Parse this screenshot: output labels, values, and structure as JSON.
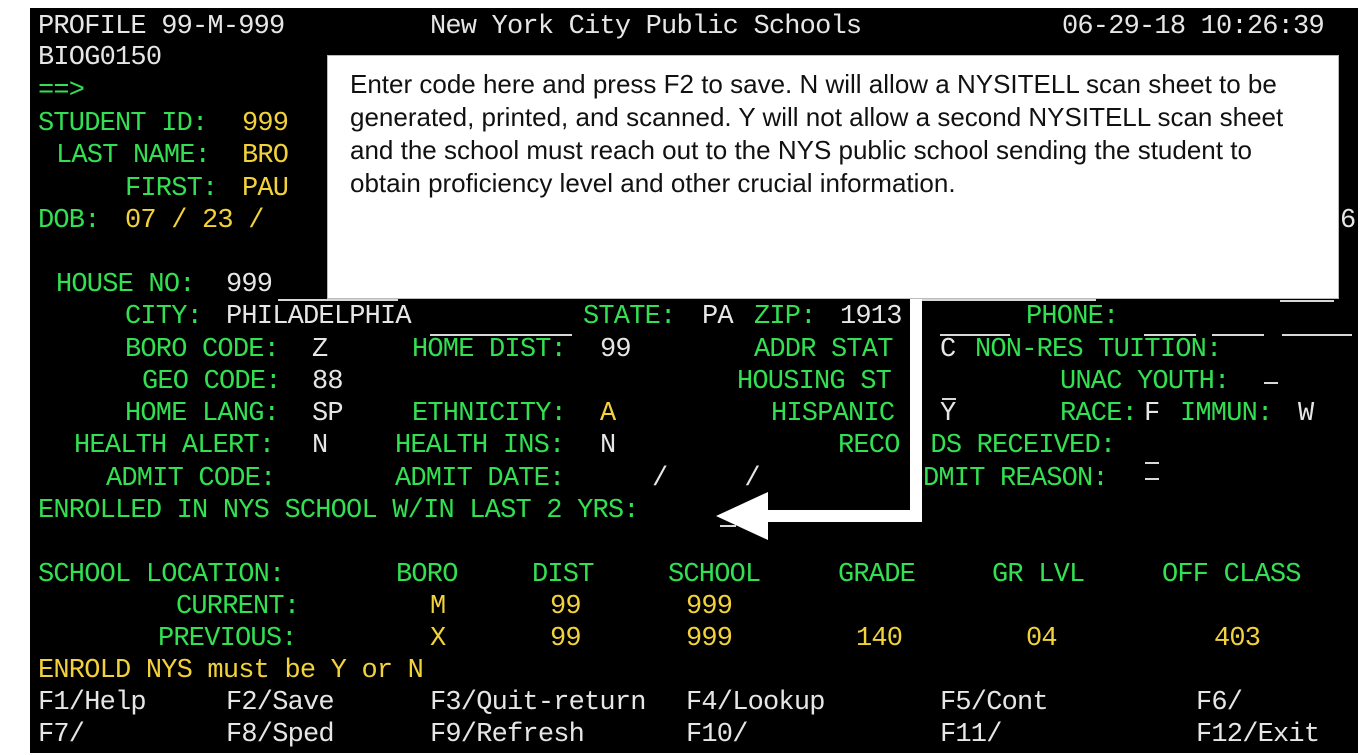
{
  "header": {
    "profile": "PROFILE 99-M-999",
    "system_title": "New York City Public Schools",
    "datetime": "06-29-18 10:26:39",
    "screen_code": "BIOG0150",
    "command_prompt": "==>"
  },
  "student": {
    "id_label": "STUDENT ID:",
    "id_value": "999",
    "last_name_label": "LAST NAME:",
    "last_name_value": "BRO",
    "first_label": "FIRST:",
    "first_value": "PAU",
    "dob_label": "DOB:",
    "dob_value": "07 / 23 /",
    "right_edge_digit": "6"
  },
  "address": {
    "house_no_label": "HOUSE NO:",
    "house_no_value": "999",
    "city_label": "CITY:",
    "city_value": "PHILADELPHIA",
    "state_label": "STATE:",
    "state_value": "PA",
    "zip_label": "ZIP:",
    "zip_value": "1913",
    "phone_label": "PHONE:"
  },
  "details": {
    "boro_code_label": "BORO CODE:",
    "boro_code_value": "Z",
    "home_dist_label": "HOME DIST:",
    "home_dist_value": "99",
    "addr_stat_label": "ADDR STAT",
    "addr_stat_value": "C",
    "non_res_label": "NON-RES TUITION:",
    "geo_code_label": "GEO CODE:",
    "geo_code_value": "88",
    "housing_label": "HOUSING ST",
    "unac_label": "UNAC YOUTH:",
    "home_lang_label": "HOME LANG:",
    "home_lang_value": "SP",
    "ethnicity_label": "ETHNICITY:",
    "ethnicity_value": "A",
    "hispanic_label": "HISPANIC",
    "hispanic_value": "Y",
    "race_label": "RACE:",
    "race_value": "F",
    "immun_label": "IMMUN:",
    "immun_value": "W",
    "health_alert_label": "HEALTH ALERT:",
    "health_alert_value": "N",
    "health_ins_label": "HEALTH INS:",
    "health_ins_value": "N",
    "records_label": "RECO  DS RECEIVED:",
    "admit_code_label": "ADMIT CODE:",
    "admit_date_label": "ADMIT DATE:",
    "admit_date_value": "/     /",
    "admit_reason_label": "DMIT REASON:",
    "enrolled_label": "ENROLLED IN NYS SCHOOL W/IN LAST 2 YRS:"
  },
  "location": {
    "heading": "SCHOOL LOCATION:",
    "columns": [
      "BORO",
      "DIST",
      "SCHOOL",
      "GRADE",
      "GR LVL",
      "OFF CLASS"
    ],
    "current_label": "CURRENT:",
    "current": {
      "boro": "M",
      "dist": "99",
      "school": "999"
    },
    "previous_label": "PREVIOUS:",
    "previous": {
      "boro": "X",
      "dist": "99",
      "school": "999",
      "grade": "140",
      "gr_lvl": "04",
      "off_class": "403"
    }
  },
  "message": "ENROLD NYS must be Y or N",
  "fkeys": {
    "f1": "F1/Help",
    "f2": "F2/Save",
    "f3": "F3/Quit-return",
    "f4": "F4/Lookup",
    "f5": "F5/Cont",
    "f6": "F6/",
    "f7": "F7/",
    "f8": "F8/Sped",
    "f9": "F9/Refresh",
    "f10": "F10/",
    "f11": "F11/",
    "f12": "F12/Exit"
  },
  "callout": {
    "text": "Enter code here and press F2 to save. N will allow a NYSITELL scan sheet to be generated, printed, and scanned. Y will not allow a second NYSITELL scan sheet and the school must reach out to the NYS public school sending the student to obtain proficiency level and other crucial information."
  },
  "colors": {
    "background": "#000000",
    "label_green": "#32e052",
    "value_white": "#e6e6e6",
    "message_yellow": "#f2d23a",
    "callout_bg": "#ffffff"
  }
}
